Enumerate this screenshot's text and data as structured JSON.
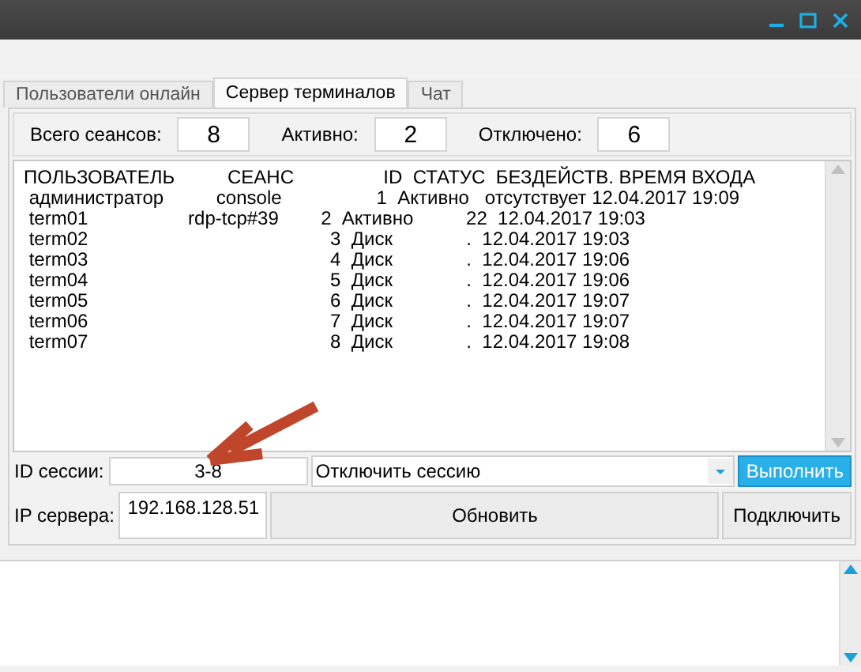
{
  "tabs": [
    {
      "label": "Пользователи онлайн",
      "selected": false
    },
    {
      "label": "Сервер терминалов",
      "selected": true
    },
    {
      "label": "Чат",
      "selected": false
    }
  ],
  "stats": [
    {
      "label": "Всего сеансов:",
      "value": "8"
    },
    {
      "label": "Активно:",
      "value": "2"
    },
    {
      "label": "Отключено:",
      "value": "6"
    }
  ],
  "session_list": {
    "lines": [
      "ПОЛЬЗОВАТЕЛЬ          СЕАНС                 ID  СТАТУС  БЕЗДЕЙСТВ. ВРЕМЯ ВХОДА",
      " администратор          console                  1  Активно   отсутствует 12.04.2017 19:09",
      " term01                   rdp-tcp#39        2  Активно          22  12.04.2017 19:03",
      " term02                                              3  Диск              .  12.04.2017 19:03",
      " term03                                              4  Диск              .  12.04.2017 19:06",
      " term04                                              5  Диск              .  12.04.2017 19:06",
      " term05                                              6  Диск              .  12.04.2017 19:07",
      " term06                                              7  Диск              .  12.04.2017 19:07",
      " term07                                              8  Диск              .  12.04.2017 19:08"
    ]
  },
  "session_id": {
    "label": "ID сессии:",
    "value": "3-8"
  },
  "action": {
    "value": "Отключить сессию",
    "button": "Выполнить"
  },
  "server_ip": {
    "label": "IP сервера:",
    "value": "192.168.128.51"
  },
  "refresh_button": "Обновить",
  "connect_button": "Подключить"
}
